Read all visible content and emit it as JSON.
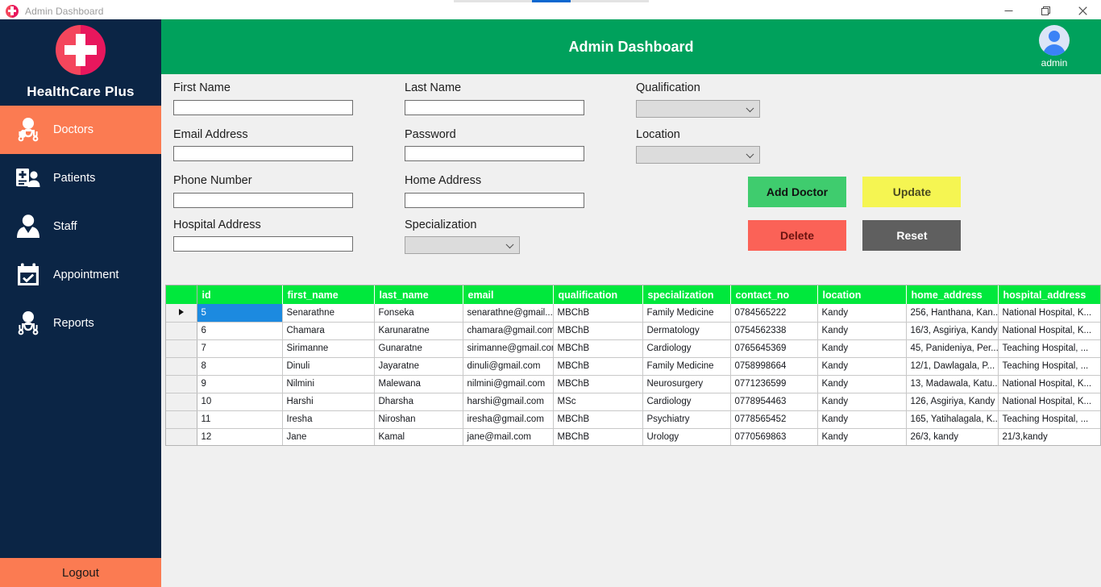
{
  "window": {
    "title": "Admin Dashboard",
    "icon": "medical-cross-icon",
    "minimize_label": "—",
    "maximize_label": "❐",
    "close_label": "✕"
  },
  "sidebar": {
    "brand_name": "HealthCare Plus",
    "brand_logo": "medical-cross-logo",
    "items": [
      {
        "label": "Doctors",
        "icon": "doctor-icon",
        "active": true
      },
      {
        "label": "Patients",
        "icon": "patient-icon",
        "active": false
      },
      {
        "label": "Staff",
        "icon": "staff-icon",
        "active": false
      },
      {
        "label": "Appointment",
        "icon": "calendar-check-icon",
        "active": false
      },
      {
        "label": "Reports",
        "icon": "reports-icon",
        "active": false
      }
    ],
    "logout_label": "Logout"
  },
  "header": {
    "title": "Admin Dashboard",
    "user_name": "admin",
    "avatar_icon": "user-avatar-icon",
    "bg_color": "#00a15c"
  },
  "form": {
    "first_name": {
      "label": "First Name",
      "value": "",
      "placeholder": ""
    },
    "last_name": {
      "label": "Last Name",
      "value": "",
      "placeholder": ""
    },
    "qualification": {
      "label": "Qualification",
      "value": ""
    },
    "email": {
      "label": "Email Address",
      "value": "",
      "placeholder": ""
    },
    "password": {
      "label": "Password",
      "value": "",
      "placeholder": ""
    },
    "location": {
      "label": "Location",
      "value": ""
    },
    "phone": {
      "label": "Phone Number",
      "value": "",
      "placeholder": ""
    },
    "home_address": {
      "label": "Home Address",
      "value": "",
      "placeholder": ""
    },
    "hospital_address": {
      "label": "Hospital Address",
      "value": "",
      "placeholder": ""
    },
    "specialization": {
      "label": "Specialization",
      "value": ""
    }
  },
  "buttons": {
    "add": {
      "label": "Add Doctor",
      "color": "#3fcc6e"
    },
    "update": {
      "label": "Update",
      "color": "#f5f552"
    },
    "delete": {
      "label": "Delete",
      "color": "#fb6257"
    },
    "reset": {
      "label": "Reset",
      "color": "#5f5f5f"
    }
  },
  "grid": {
    "header_color": "#00e83c",
    "selected_row_color": "#1c8ae0",
    "columns": [
      "id",
      "first_name",
      "last_name",
      "email",
      "qualification",
      "specialization",
      "contact_no",
      "location",
      "home_address",
      "hospital_address"
    ],
    "selected_index": 0,
    "rows": [
      {
        "id": "5",
        "first_name": "Senarathne",
        "last_name": "Fonseka",
        "email": "senarathne@gmail....",
        "qualification": "MBChB",
        "specialization": "Family Medicine",
        "contact_no": "0784565222",
        "location": "Kandy",
        "home_address": "256, Hanthana, Kan...",
        "hospital_address": "National Hospital, K..."
      },
      {
        "id": "6",
        "first_name": "Chamara",
        "last_name": "Karunaratne",
        "email": "chamara@gmail.com",
        "qualification": "MBChB",
        "specialization": "Dermatology",
        "contact_no": "0754562338",
        "location": "Kandy",
        "home_address": "16/3, Asgiriya, Kandy",
        "hospital_address": "National Hospital, K..."
      },
      {
        "id": "7",
        "first_name": "Sirimanne",
        "last_name": "Gunaratne",
        "email": "sirimanne@gmail.com",
        "qualification": "MBChB",
        "specialization": "Cardiology",
        "contact_no": "0765645369",
        "location": "Kandy",
        "home_address": "45, Panideniya, Per...",
        "hospital_address": "Teaching Hospital, ..."
      },
      {
        "id": "8",
        "first_name": "Dinuli",
        "last_name": "Jayaratne",
        "email": "dinuli@gmail.com",
        "qualification": "MBChB",
        "specialization": "Family Medicine",
        "contact_no": "0758998664",
        "location": "Kandy",
        "home_address": "12/1, Dawlagala, P...",
        "hospital_address": "Teaching Hospital, ..."
      },
      {
        "id": "9",
        "first_name": "Nilmini",
        "last_name": "Malewana",
        "email": "nilmini@gmail.com",
        "qualification": "MBChB",
        "specialization": "Neurosurgery",
        "contact_no": "0771236599",
        "location": "Kandy",
        "home_address": "13, Madawala, Katu...",
        "hospital_address": "National Hospital, K..."
      },
      {
        "id": "10",
        "first_name": "Harshi",
        "last_name": "Dharsha",
        "email": "harshi@gmail.com",
        "qualification": "MSc",
        "specialization": "Cardiology",
        "contact_no": "0778954463",
        "location": "Kandy",
        "home_address": "126, Asgiriya, Kandy",
        "hospital_address": "National Hospital, K..."
      },
      {
        "id": "11",
        "first_name": "Iresha",
        "last_name": "Niroshan",
        "email": "iresha@gmail.com",
        "qualification": "MBChB",
        "specialization": "Psychiatry",
        "contact_no": "0778565452",
        "location": "Kandy",
        "home_address": "165, Yatihalagala, K...",
        "hospital_address": "Teaching Hospital, ..."
      },
      {
        "id": "12",
        "first_name": "Jane",
        "last_name": "Kamal",
        "email": "jane@mail.com",
        "qualification": "MBChB",
        "specialization": "Urology",
        "contact_no": "0770569863",
        "location": "Kandy",
        "home_address": "26/3, kandy",
        "hospital_address": "21/3,kandy"
      }
    ]
  }
}
